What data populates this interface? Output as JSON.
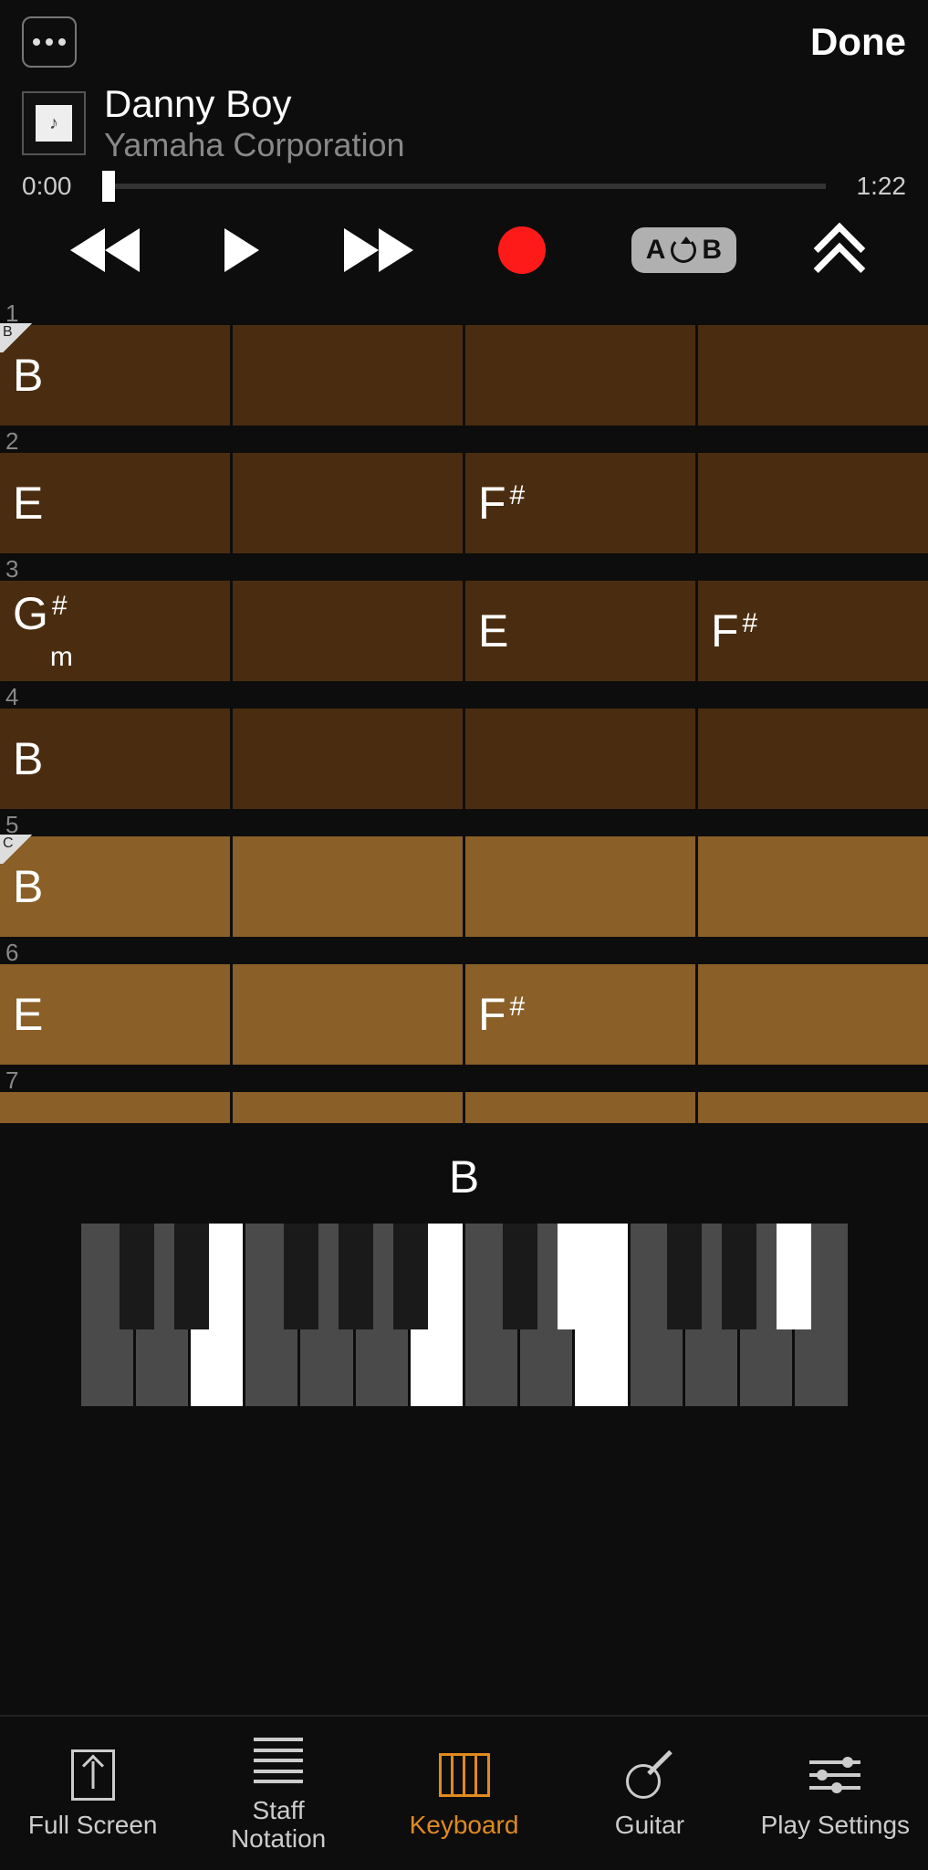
{
  "topbar": {
    "done": "Done"
  },
  "song": {
    "title": "Danny Boy",
    "artist": "Yamaha Corporation"
  },
  "progress": {
    "current": "0:00",
    "total": "1:22"
  },
  "controls": {
    "ab_a": "A",
    "ab_b": "B"
  },
  "rows": [
    {
      "num": "1",
      "style": "dark",
      "tag": "B",
      "cells": [
        "B",
        "",
        "",
        ""
      ]
    },
    {
      "num": "2",
      "style": "dark",
      "tag": "",
      "cells": [
        "E",
        "",
        "F#",
        ""
      ]
    },
    {
      "num": "3",
      "style": "dark",
      "tag": "",
      "cells": [
        "G#m",
        "",
        "E",
        "F#"
      ]
    },
    {
      "num": "4",
      "style": "dark",
      "tag": "",
      "cells": [
        "B",
        "",
        "",
        ""
      ]
    },
    {
      "num": "5",
      "style": "light",
      "tag": "C",
      "cells": [
        "B",
        "",
        "",
        ""
      ]
    },
    {
      "num": "6",
      "style": "light",
      "tag": "",
      "cells": [
        "E",
        "",
        "F#",
        ""
      ]
    }
  ],
  "row7_num": "7",
  "piano": {
    "chord": "B",
    "white_on": [
      2,
      6,
      9
    ],
    "black_pos": [
      42,
      102,
      222,
      282,
      342,
      462,
      522,
      642,
      702,
      762
    ],
    "black_on": [
      6,
      9
    ]
  },
  "tabs": {
    "full": "Full Screen",
    "staff1": "Staff",
    "staff2": "Notation",
    "keyboard": "Keyboard",
    "guitar": "Guitar",
    "settings": "Play Settings"
  }
}
